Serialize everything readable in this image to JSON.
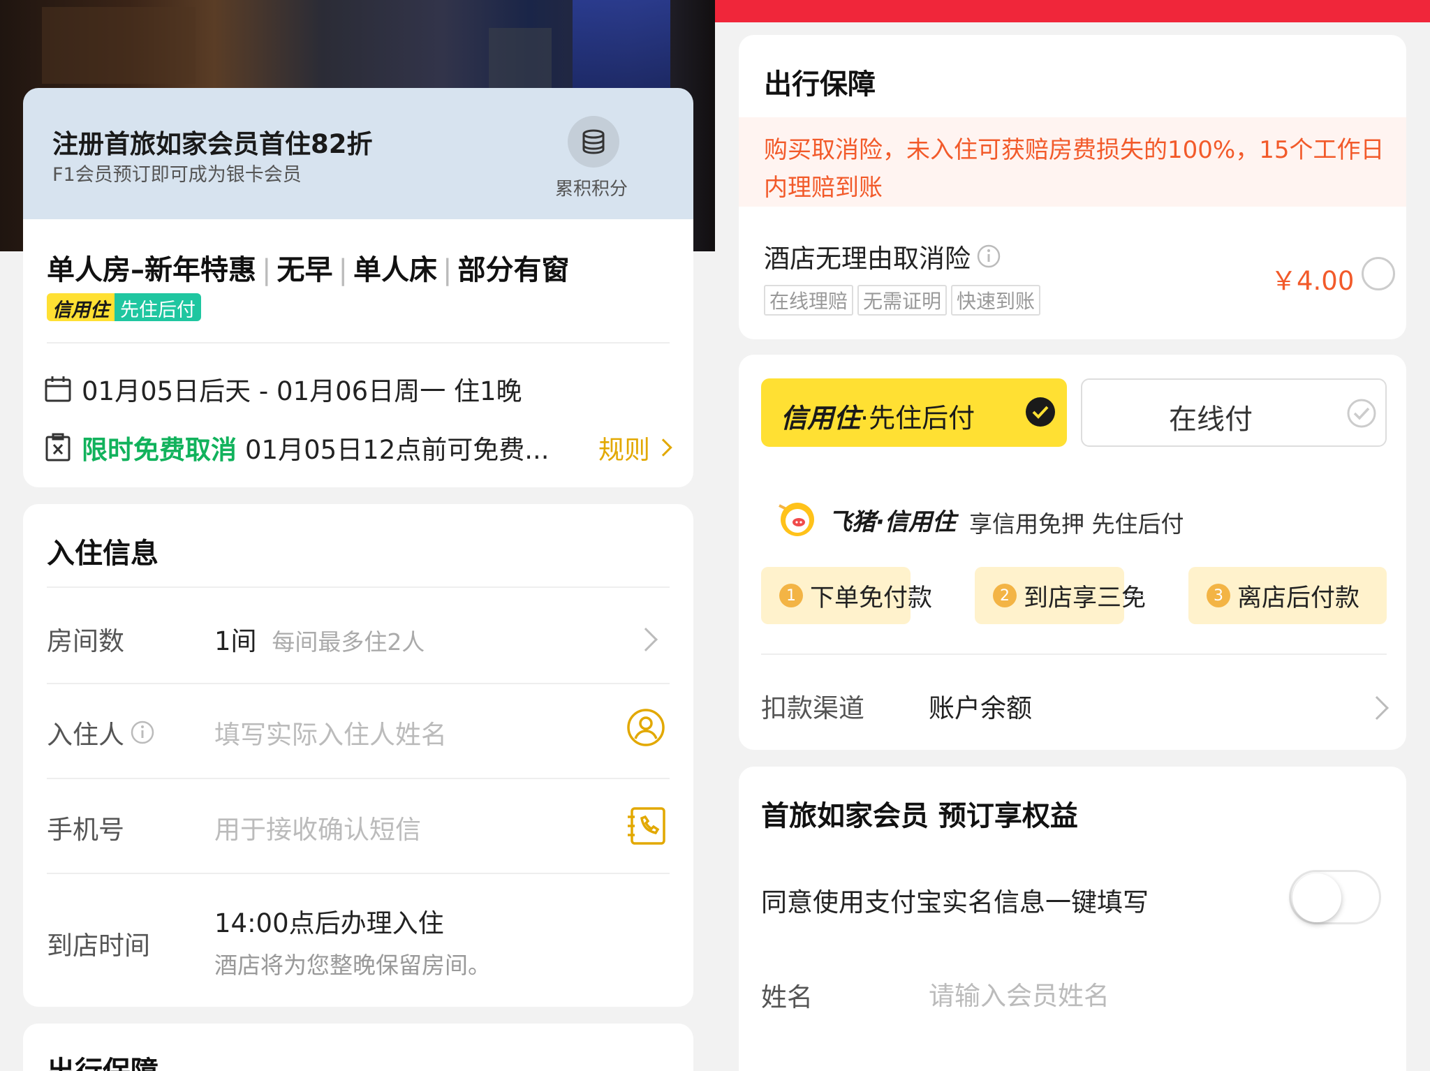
{
  "left": {
    "promo": {
      "title": "注册首旅如家会员首住82折",
      "subtitle": "F1会员预订即可成为银卡会员",
      "points_label": "累积积分"
    },
    "room": {
      "title_parts": [
        "单人房–新年特惠",
        "无早",
        "单人床",
        "部分有窗"
      ],
      "badge_credit": "信用住",
      "badge_paylater": "先住后付"
    },
    "stay": {
      "dates": "01月05日后天 - 01月06日周一 住1晚",
      "cancel_tag": "限时免费取消",
      "cancel_text": "01月05日12点前可免费...",
      "rules_label": "规则"
    },
    "checkin": {
      "section_title": "入住信息",
      "rooms_label": "房间数",
      "rooms_value": "1间",
      "rooms_hint": "每间最多住2人",
      "guest_label": "入住人",
      "guest_placeholder": "填写实际入住人姓名",
      "phone_label": "手机号",
      "phone_placeholder": "用于接收确认短信",
      "arrival_label": "到店时间",
      "arrival_value": "14:00点后办理入住",
      "arrival_note": "酒店将为您整晚保留房间。"
    },
    "next_section_title": "出行保障"
  },
  "right": {
    "insurance": {
      "section_title": "出行保障",
      "warning": "购买取消险，未入住可获赔房费损失的100%，15个工作日内理赔到账",
      "product_name": "酒店无理由取消险",
      "tags": [
        "在线理赔",
        "无需证明",
        "快速到账"
      ],
      "price": "￥4.00"
    },
    "payment": {
      "option_credit_brand": "信用住",
      "option_credit_label": "·先住后付",
      "option_online": "在线付",
      "fliggy_brand": "飞猪·信用住",
      "fliggy_slogan": "享信用免押 先住后付",
      "steps": [
        {
          "num": "1",
          "label": "下单免付款"
        },
        {
          "num": "2",
          "label": "到店享三免"
        },
        {
          "num": "3",
          "label": "离店后付款"
        }
      ],
      "channel_label": "扣款渠道",
      "channel_value": "账户余额"
    },
    "member": {
      "section_title": "首旅如家会员 预订享权益",
      "autofill_label": "同意使用支付宝实名信息一键填写",
      "name_label": "姓名",
      "name_placeholder": "请输入会员姓名"
    }
  },
  "colors": {
    "accent_yellow": "#ffe033",
    "accent_red": "#f0263a",
    "warning_orange": "#f25a2a",
    "success_green": "#11b25c",
    "rule_gold": "#e2a800"
  }
}
